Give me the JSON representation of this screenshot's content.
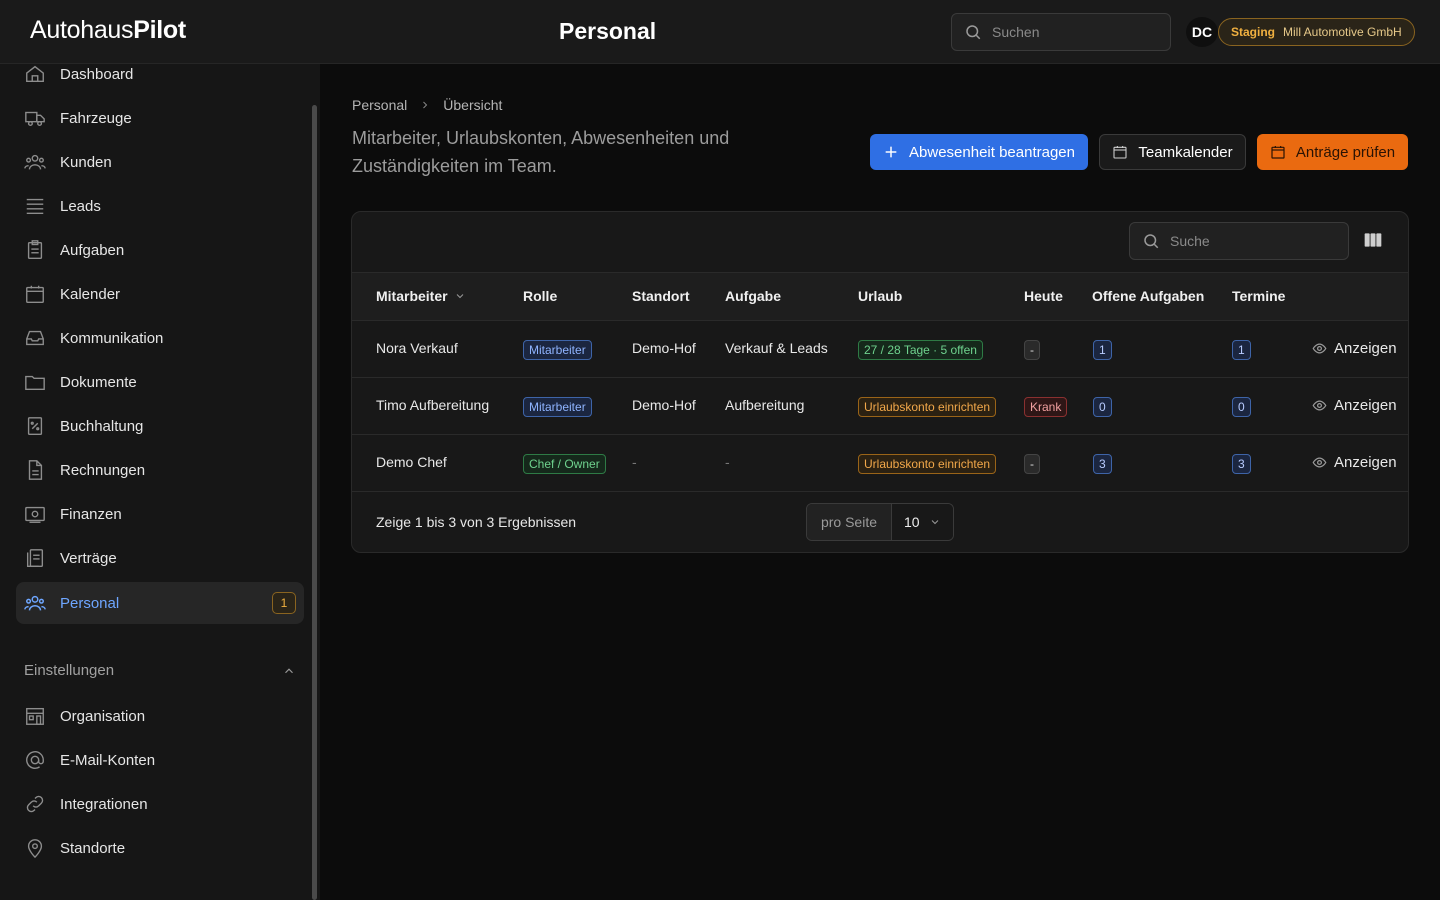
{
  "app": {
    "logo_light": "Autohaus",
    "logo_bold": "Pilot",
    "page_title": "Personal",
    "search_placeholder": "Suchen",
    "avatar_initials": "DC",
    "environment": "Staging",
    "organization": "Mill Automotive GmbH"
  },
  "sidebar": {
    "items": [
      {
        "label": "Dashboard",
        "icon": "home-icon"
      },
      {
        "label": "Fahrzeuge",
        "icon": "truck-icon"
      },
      {
        "label": "Kunden",
        "icon": "users-icon"
      },
      {
        "label": "Leads",
        "icon": "list-icon"
      },
      {
        "label": "Aufgaben",
        "icon": "clipboard-icon"
      },
      {
        "label": "Kalender",
        "icon": "calendar-icon"
      },
      {
        "label": "Kommunikation",
        "icon": "inbox-icon"
      },
      {
        "label": "Dokumente",
        "icon": "folder-icon"
      },
      {
        "label": "Buchhaltung",
        "icon": "receipt-icon"
      },
      {
        "label": "Rechnungen",
        "icon": "document-icon"
      },
      {
        "label": "Finanzen",
        "icon": "banknote-icon"
      },
      {
        "label": "Verträge",
        "icon": "contract-icon"
      },
      {
        "label": "Personal",
        "icon": "team-icon",
        "badge": "1",
        "active": true
      }
    ],
    "settings_section": "Einstellungen",
    "settings_items": [
      {
        "label": "Organisation",
        "icon": "building-icon"
      },
      {
        "label": "E-Mail-Konten",
        "icon": "at-icon"
      },
      {
        "label": "Integrationen",
        "icon": "link-icon"
      },
      {
        "label": "Standorte",
        "icon": "map-pin-icon"
      }
    ]
  },
  "main": {
    "breadcrumb": [
      "Personal",
      "Übersicht"
    ],
    "subtitle": "Mitarbeiter, Urlaubskonten, Abwesenheiten und Zuständigkeiten im Team.",
    "actions": {
      "request_absence": "Abwesenheit beantragen",
      "team_calendar": "Teamkalender",
      "review_requests": "Anträge prüfen"
    },
    "table": {
      "search_placeholder": "Suche",
      "columns": [
        "Mitarbeiter",
        "Rolle",
        "Standort",
        "Aufgabe",
        "Urlaub",
        "Heute",
        "Offene Aufgaben",
        "Termine"
      ],
      "rows": [
        {
          "name": "Nora Verkauf",
          "role": "Mitarbeiter",
          "location": "Demo-Hof",
          "task": "Verkauf & Leads",
          "vacation": "27 / 28 Tage · 5 offen",
          "today": "-",
          "open_tasks": "1",
          "appointments": "1",
          "action": "Anzeigen"
        },
        {
          "name": "Timo Aufbereitung",
          "role": "Mitarbeiter",
          "location": "Demo-Hof",
          "task": "Aufbereitung",
          "vacation": "Urlaubskonto einrichten",
          "today": "Krank",
          "open_tasks": "0",
          "appointments": "0",
          "action": "Anzeigen"
        },
        {
          "name": "Demo Chef",
          "role": "Chef / Owner",
          "location": "-",
          "task": "-",
          "vacation": "Urlaubskonto einrichten",
          "today": "-",
          "open_tasks": "3",
          "appointments": "3",
          "action": "Anzeigen"
        }
      ],
      "footer": "Zeige 1 bis 3 von 3 Ergebnissen",
      "per_page_label": "pro Seite",
      "per_page_value": "10"
    }
  },
  "colors": {
    "accent_blue": "#2f6fe4",
    "accent_orange": "#ea6a10",
    "active_nav": "#6ea6ff"
  }
}
